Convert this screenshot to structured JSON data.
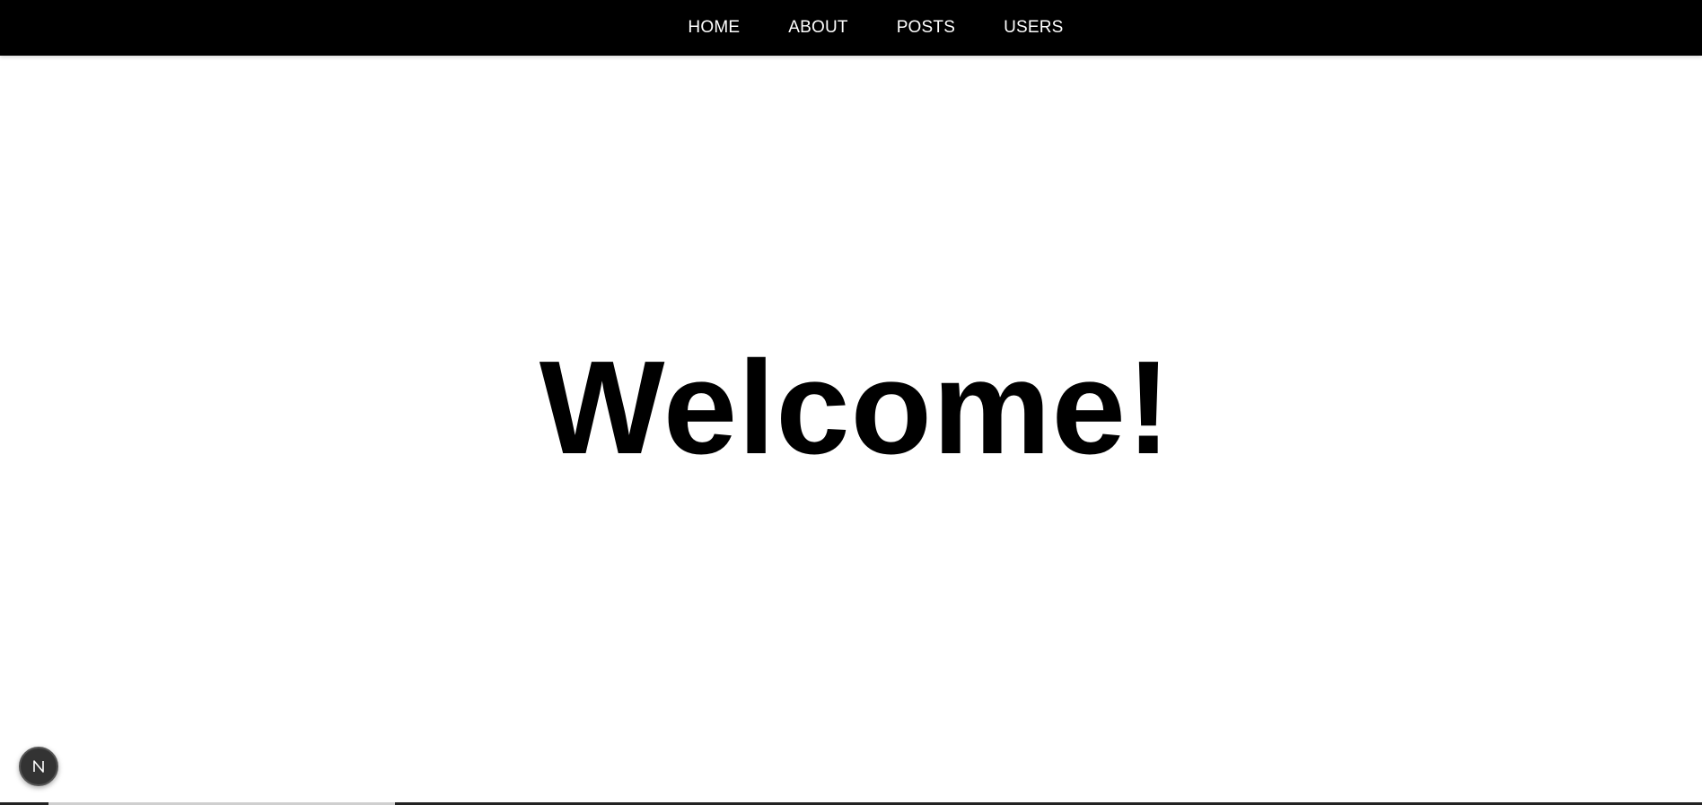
{
  "nav": {
    "items": [
      {
        "label": "HOME"
      },
      {
        "label": "ABOUT"
      },
      {
        "label": "POSTS"
      },
      {
        "label": "USERS"
      }
    ]
  },
  "hero": {
    "title": "Welcome!"
  },
  "devtools": {
    "badge_letter": "N",
    "icon": "nextjs-logo-icon"
  },
  "colors": {
    "nav_background": "#000000",
    "nav_text": "#ffffff",
    "page_background": "#ffffff",
    "title_text": "#000000"
  }
}
